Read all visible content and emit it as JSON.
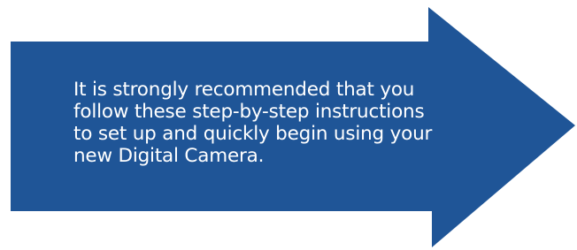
{
  "callout": {
    "text": "It is strongly recommended that you follow these step-by-step instructions to set up and quickly begin using your new Digital Camera.",
    "fill_color": "#1F5597",
    "text_color": "#FFFFFF"
  }
}
